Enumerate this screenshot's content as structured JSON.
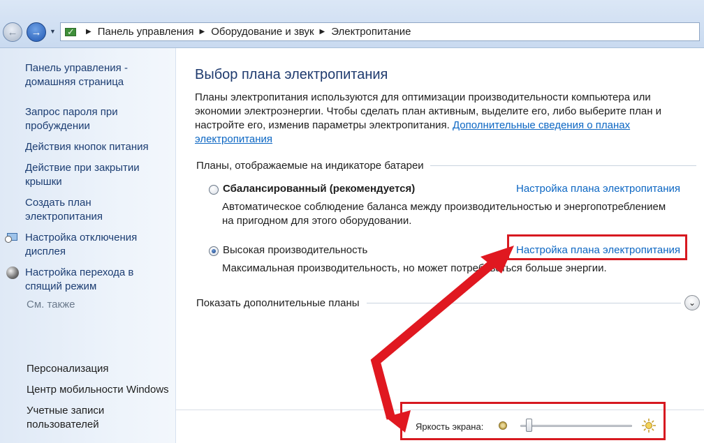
{
  "breadcrumb": {
    "items": [
      "Панель управления",
      "Оборудование и звук",
      "Электропитание"
    ]
  },
  "sidebar": {
    "links": [
      "Панель управления - домашняя страница",
      "Запрос пароля при пробуждении",
      "Действия кнопок питания",
      "Действие при закрытии крышки",
      "Создать план электропитания",
      "Настройка отключения дисплея",
      "Настройка перехода в спящий режим"
    ],
    "see_also_label": "См. также",
    "see_also": [
      "Персонализация",
      "Центр мобильности Windows",
      "Учетные записи пользователей"
    ]
  },
  "main": {
    "title": "Выбор плана электропитания",
    "intro": "Планы электропитания используются для оптимизации производительности компьютера или экономии электроэнергии. Чтобы сделать план активным, выделите его, либо выберите план и настройте его, изменив параметры электропитания.",
    "intro_link": "Дополнительные сведения о планах электропитания",
    "section_title": "Планы, отображаемые на индикаторе батареи",
    "plans": [
      {
        "name": "Сбалансированный (рекомендуется)",
        "description": "Автоматическое соблюдение баланса между производительностью и энергопотреблением на пригодном для этого оборудовании.",
        "link": "Настройка плана электропитания",
        "selected": false
      },
      {
        "name": "Высокая производительность",
        "description": "Максимальная производительность, но может потребоваться больше энергии.",
        "link": "Настройка плана электропитания",
        "selected": true
      }
    ],
    "more_plans": "Показать дополнительные планы",
    "brightness_label": "Яркость экрана:",
    "brightness_level": 0.05
  },
  "colors": {
    "link": "#0b66c3",
    "annotation": "#d71920",
    "title": "#1e3a6e"
  }
}
